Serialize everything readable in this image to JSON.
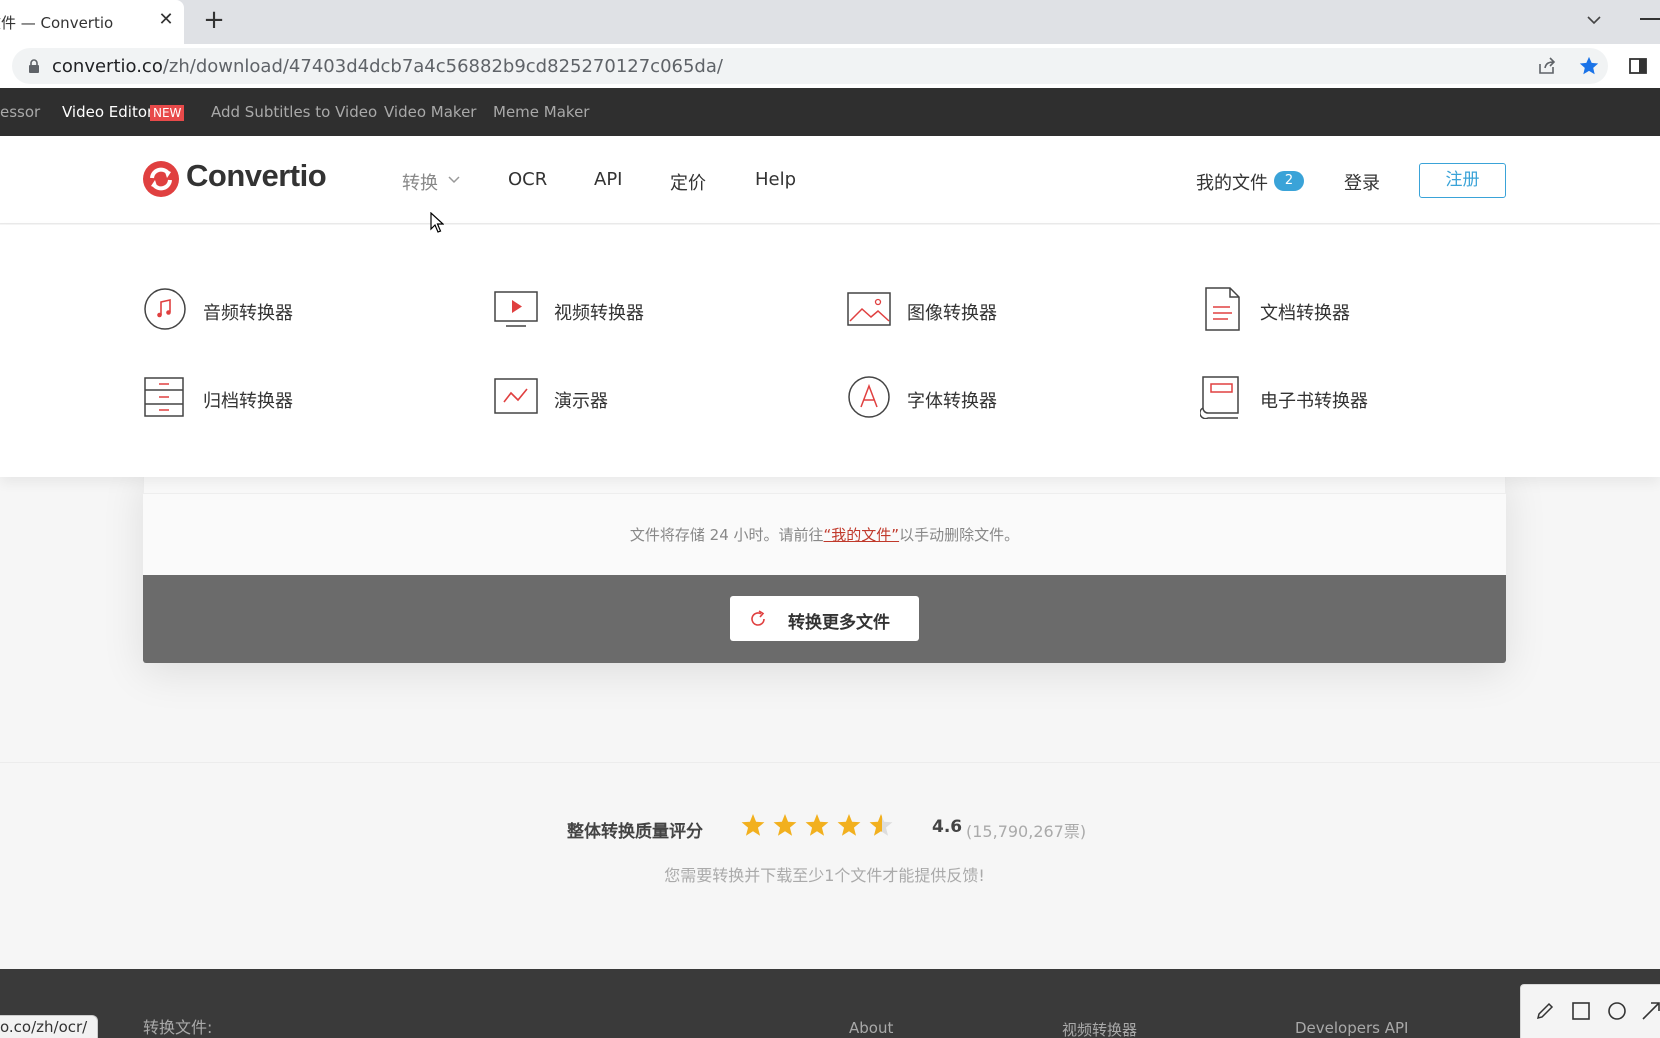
{
  "browser": {
    "tab_title": "文件 — Convertio",
    "tab_close": "✕",
    "new_tab": "+",
    "url_host": "convertio.co",
    "url_path": "/zh/download/47403d4dcb7a4c56882b9cd825270127c065da/"
  },
  "topnav": {
    "items": [
      "essor",
      "Video Editor",
      "Add Subtitles to Video",
      "Video Maker",
      "Meme Maker"
    ],
    "new_badge": "NEW"
  },
  "header": {
    "logo": "Convertio",
    "nav": [
      "转换",
      "OCR",
      "API",
      "定价",
      "Help"
    ],
    "my_files": "我的文件",
    "files_count": "2",
    "login": "登录",
    "signup": "注册"
  },
  "mega_menu": {
    "items": [
      {
        "label": "音频转换器",
        "icon": "music-note-icon"
      },
      {
        "label": "视频转换器",
        "icon": "video-play-icon"
      },
      {
        "label": "图像转换器",
        "icon": "image-icon"
      },
      {
        "label": "文档转换器",
        "icon": "document-icon"
      },
      {
        "label": "归档转换器",
        "icon": "archive-icon"
      },
      {
        "label": "演示器",
        "icon": "presentation-icon"
      },
      {
        "label": "字体转换器",
        "icon": "font-icon"
      },
      {
        "label": "电子书转换器",
        "icon": "ebook-icon"
      }
    ]
  },
  "main": {
    "store_note_pre": "文件将存储 24 小时。请前往",
    "store_note_link": "“我的文件”",
    "store_note_post": "以手动删除文件。",
    "convert_more": "转换更多文件"
  },
  "rating": {
    "title": "整体转换质量评分",
    "score": "4.6",
    "votes": "(15,790,267票)",
    "stars_value": 4.6,
    "hint": "您需要转换并下载至少1个文件才能提供反馈!"
  },
  "footer": {
    "left_label": "转换文件:",
    "links": [
      "About",
      "视频转换器",
      "Developers API"
    ]
  },
  "status_bar": {
    "url": "o.co/zh/ocr/"
  },
  "colors": {
    "accent_red": "#e04040",
    "accent_blue": "#3aa3d8",
    "star_yellow": "#f2b01e",
    "dark_nav": "#2f2f2f"
  }
}
